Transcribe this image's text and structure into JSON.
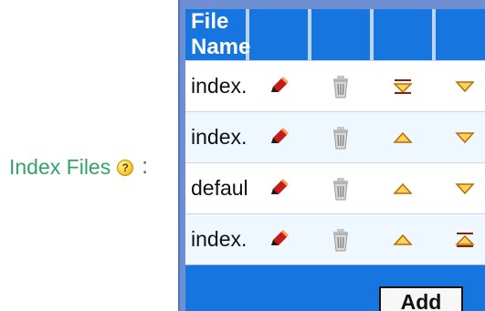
{
  "section": {
    "label": "Index Files",
    "colon": ":",
    "help_symbol": "?"
  },
  "table": {
    "header_name": "File Name",
    "rows": [
      {
        "name": "index.html",
        "edit_icon": "pencil-icon",
        "delete_icon": "trash-icon",
        "move_icon": "move-top-icon",
        "order_icon": "move-down-icon"
      },
      {
        "name": "index.htm",
        "edit_icon": "pencil-icon",
        "delete_icon": "trash-icon",
        "move_icon": "move-up-icon",
        "order_icon": "move-down-icon"
      },
      {
        "name": "default.aspx",
        "edit_icon": "pencil-icon",
        "delete_icon": "trash-icon",
        "move_icon": "move-up-icon",
        "order_icon": "move-down-icon"
      },
      {
        "name": "index.py",
        "edit_icon": "pencil-icon",
        "delete_icon": "trash-icon",
        "move_icon": "move-up-icon",
        "order_icon": "move-bottom-icon"
      }
    ],
    "add_label": "Add"
  },
  "colors": {
    "label_green": "#34a36a",
    "header_blue": "#1675df",
    "row_tint": "#f0f8ff",
    "icon_orange": "#d88700",
    "pencil_red": "#c51b1b",
    "trash_gray": "#b8b8b8"
  }
}
